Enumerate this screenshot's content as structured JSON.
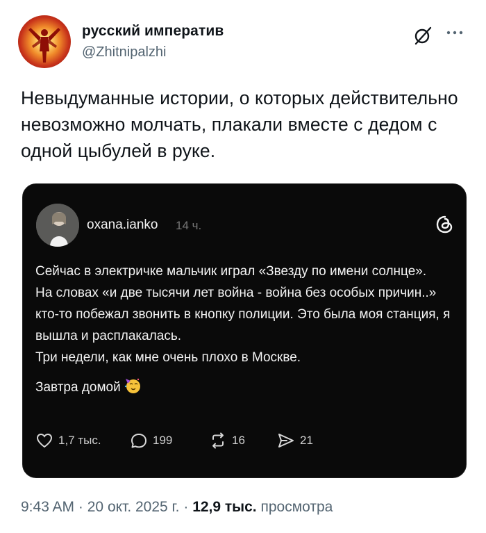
{
  "author": {
    "display_name": "русский императив",
    "handle": "@Zhitnipalzhi",
    "avatar_icon": "avatar-image"
  },
  "header_actions": {
    "grok_icon": "grok-icon",
    "more_icon": "more-icon"
  },
  "post": {
    "text": "Невыдуманные истории, о которых действительно невозможно молчать, плакали вместе с дедом с одной цыбулей в руке."
  },
  "embedded_post": {
    "platform_icon": "threads-icon",
    "username": "oxana.ianko",
    "time_ago": "14 ч.",
    "paragraph_1": "Сейчас в электричке мальчик играл «Звезду по имени солнце».",
    "paragraph_2": "На словах «и две тысячи лет война - война без особых причин..» кто-то побежал звонить в кнопку полиции. Это была моя станция, я вышла и расплакалась.",
    "paragraph_3": "Три недели, как мне очень плохо в Москве.",
    "paragraph_4": "Завтра домой",
    "emoji_icon": "partying-face-emoji",
    "likes": "1,7 тыс.",
    "replies": "199",
    "reposts": "16",
    "shares": "21"
  },
  "meta": {
    "time": "9:43 AM",
    "date": "20 окт. 2025 г.",
    "separator": "·",
    "views_count": "12,9 тыс.",
    "views_label": "просмотра"
  },
  "colors": {
    "text_primary": "#0f1419",
    "text_secondary": "#536471",
    "card_bg": "#0a0a0a"
  }
}
